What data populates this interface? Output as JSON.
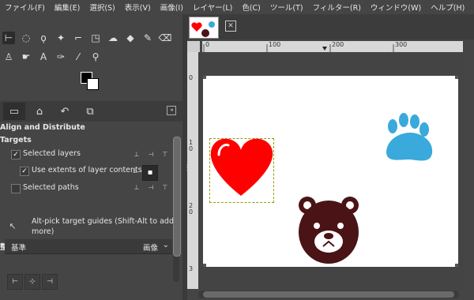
{
  "menu": [
    "ファイル(F)",
    "編集(E)",
    "選択(S)",
    "表示(V)",
    "画像(I)",
    "レイヤー(L)",
    "色(C)",
    "ツール(T)",
    "フィルター(R)",
    "ウィンドウ(W)",
    "ヘルプ(H)"
  ],
  "tools_row1": [
    "align-tool-icon",
    "ellipse-select-icon",
    "free-select-icon",
    "fuzzy-select-icon",
    "crop-icon",
    "unified-transform-icon",
    "warp-icon",
    "bucket-fill-icon",
    "paintbrush-icon",
    "eraser-icon"
  ],
  "tools_row2": [
    "clone-icon",
    "smudge-icon",
    "text-icon",
    "path-icon",
    "color-picker-icon",
    "zoom-icon"
  ],
  "panel": {
    "title": "Align and Distribute",
    "targets_heading": "Targets",
    "selected_layers": "Selected layers",
    "use_extents": "Use extents of layer contents",
    "selected_paths": "Selected paths",
    "alt_pick": "Alt-pick target guides (Shift-Alt to add",
    "alt_pick2": "more)",
    "section": "整列",
    "relative_label": "基準",
    "relative_value": "画像"
  },
  "ruler": {
    "h": [
      "0",
      "100",
      "200",
      "300"
    ],
    "v": [
      "0",
      "1",
      "0",
      "2",
      "0",
      "3"
    ]
  },
  "colors": {
    "heart": "#ff0000",
    "paw": "#3aa9dc",
    "bear": "#4a1417"
  }
}
